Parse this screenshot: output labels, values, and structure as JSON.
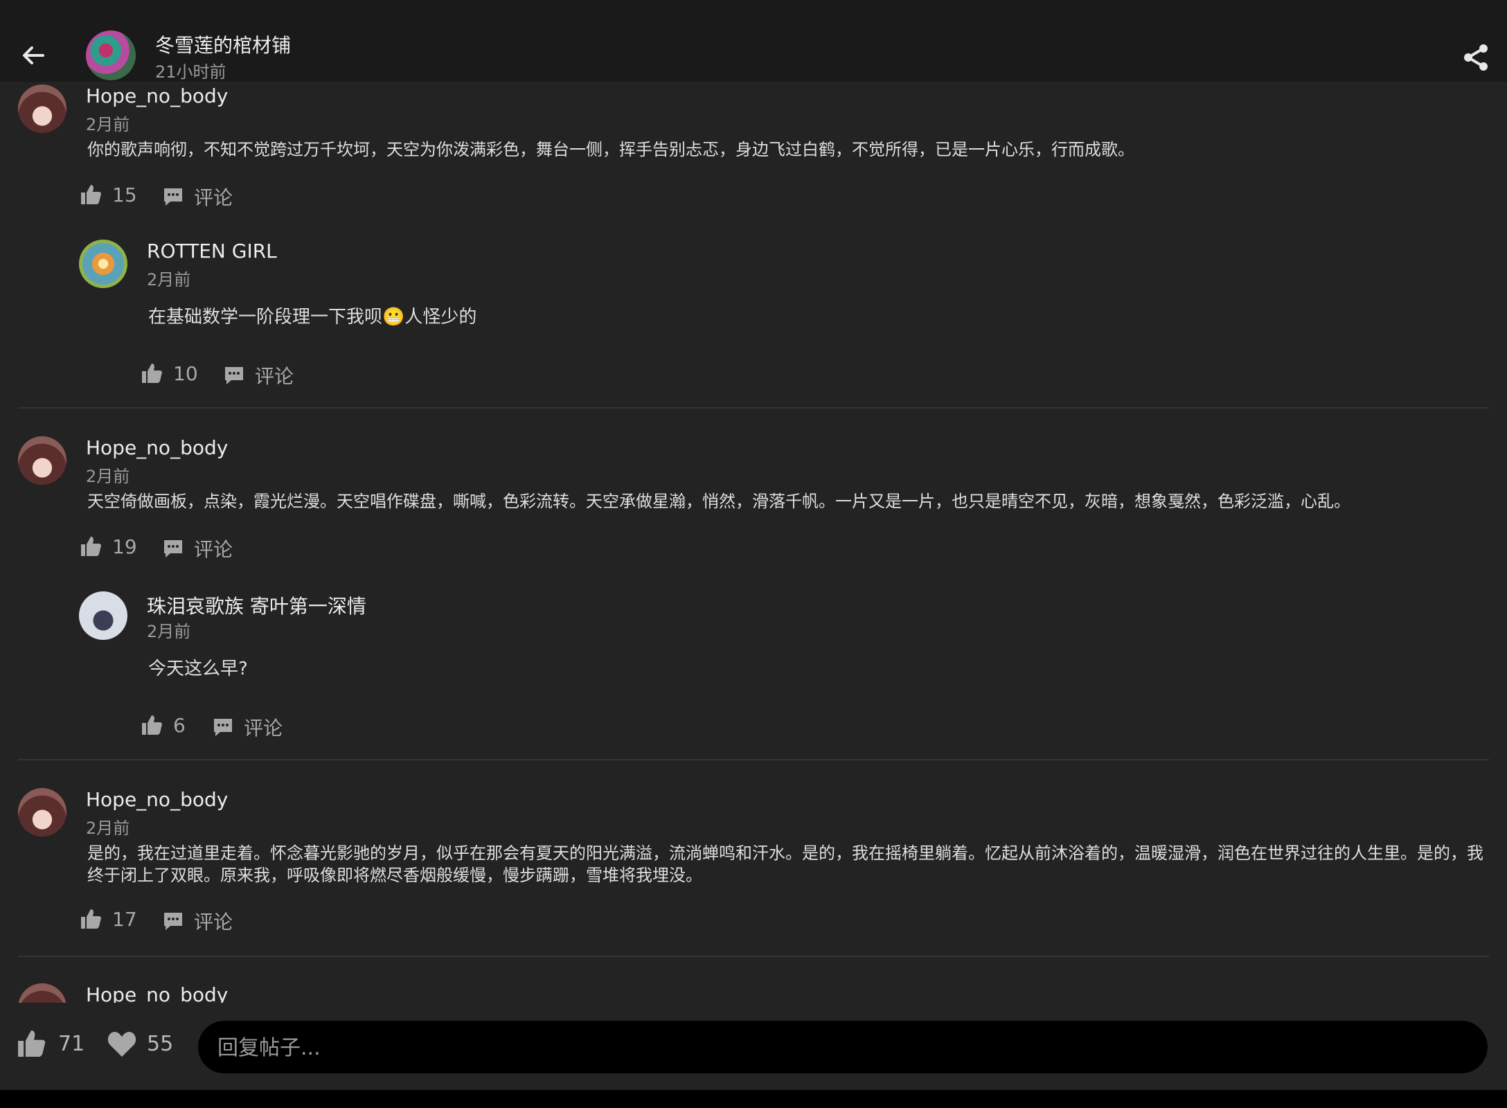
{
  "header": {
    "title": "冬雪莲的棺材铺",
    "time": "21小时前"
  },
  "comments": [
    {
      "user": "Hope_no_body",
      "time": "2月前",
      "text": "你的歌声响彻，不知不觉跨过万千坎坷，天空为你泼满彩色，舞台一侧，挥手告别忐忑，身边飞过白鹤，不觉所得，已是一片心乐，行而成歌。",
      "likes": "15",
      "comment_label": "评论",
      "reply": {
        "user": "ROTTEN GIRL",
        "time": "2月前",
        "text": "在基础数学一阶段理一下我呗😬人怪少的",
        "likes": "10",
        "comment_label": "评论"
      }
    },
    {
      "user": "Hope_no_body",
      "time": "2月前",
      "text": "天空倚做画板，点染，霞光烂漫。天空唱作碟盘，嘶喊，色彩流转。天空承做星瀚，悄然，滑落千帆。一片又是一片，也只是晴空不见，灰暗，想象戛然，色彩泛滥，心乱。",
      "likes": "19",
      "comment_label": "评论",
      "reply": {
        "user": "珠泪哀歌族 寄叶第一深情",
        "time": "2月前",
        "text": "今天这么早?",
        "likes": "6",
        "comment_label": "评论"
      }
    },
    {
      "user": "Hope_no_body",
      "time": "2月前",
      "text": "是的，我在过道里走着。怀念暮光影驰的岁月，似乎在那会有夏天的阳光满溢，流淌蝉鸣和汗水。是的，我在摇椅里躺着。忆起从前沐浴着的，温暖湿滑，润色在世界过往的人生里。是的，我终于闭上了双眼。原来我，呼吸像即将燃尽香烟般缓慢，慢步蹒跚，雪堆将我埋没。",
      "likes": "17",
      "comment_label": "评论"
    },
    {
      "user": "Hope_no_body"
    }
  ],
  "footer": {
    "likes": "71",
    "favorites": "55",
    "reply_placeholder": "回复帖子..."
  },
  "icons": {
    "back": "arrow-left-icon",
    "share": "share-icon",
    "like": "thumbs-up-icon",
    "comment": "chat-bubble-icon",
    "favorite": "heart-icon"
  }
}
